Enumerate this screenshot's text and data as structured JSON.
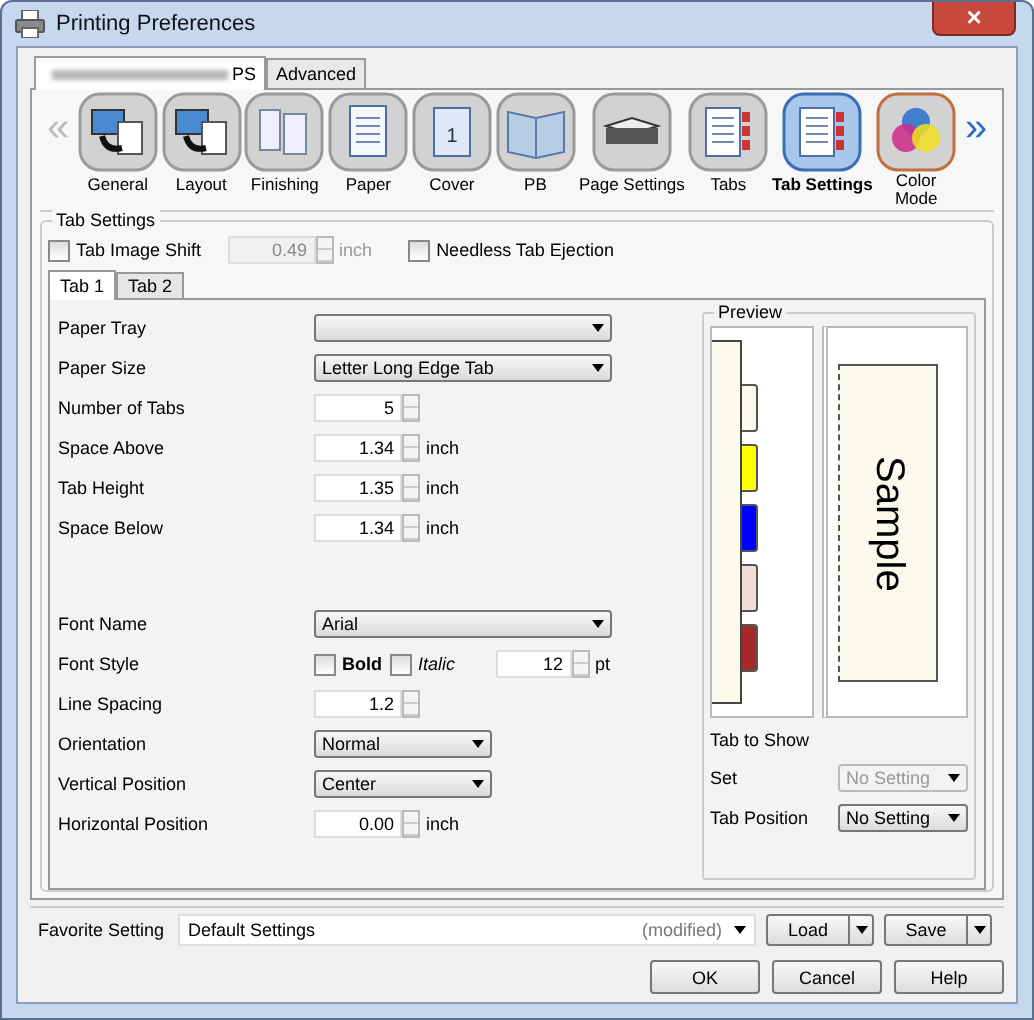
{
  "window": {
    "title": "Printing Preferences",
    "close": "×"
  },
  "outer_tabs": [
    {
      "label": "PS",
      "selected": true
    },
    {
      "label": "Advanced",
      "selected": false
    }
  ],
  "nav": {
    "prev": "«",
    "prev_disabled": true,
    "next": "»",
    "next_disabled": false
  },
  "categories": [
    {
      "kind": "general",
      "label": "General",
      "selected": false
    },
    {
      "kind": "layout",
      "label": "Layout",
      "selected": false
    },
    {
      "kind": "finishing",
      "label": "Finishing",
      "selected": false
    },
    {
      "kind": "paper",
      "label": "Paper",
      "selected": false
    },
    {
      "kind": "cover",
      "label": "Cover",
      "selected": false,
      "glyph": "1"
    },
    {
      "kind": "booklet",
      "label": "PB",
      "selected": false
    },
    {
      "kind": "stack",
      "label": "Page Settings",
      "selected": false
    },
    {
      "kind": "tabs",
      "label": "Tabs",
      "selected": false
    },
    {
      "kind": "tabsettings",
      "label": "Tab Settings",
      "selected": true
    },
    {
      "kind": "color",
      "label": "Color Mode",
      "selected": false
    }
  ],
  "tab_settings": {
    "title": "Tab Settings",
    "tab_image_shift": {
      "label": "Tab Image Shift",
      "checked": false,
      "value": "0.49",
      "unit": "inch",
      "disabled": true
    },
    "needless_tab_ejection": {
      "label": "Needless Tab Ejection",
      "checked": false
    }
  },
  "inner_tabs": [
    {
      "label": "Tab 1",
      "selected": true
    },
    {
      "label": "Tab 2",
      "selected": false
    }
  ],
  "fields_top": [
    {
      "kind": "select",
      "label": "Paper Tray"
    },
    {
      "kind": "select",
      "label": "Paper Size",
      "value": "Letter Long Edge Tab"
    },
    {
      "kind": "spin",
      "label": "Number of Tabs",
      "value": "5"
    },
    {
      "kind": "spin",
      "label": "Space Above",
      "value": "1.34",
      "unit": "inch"
    },
    {
      "kind": "spin",
      "label": "Tab Height",
      "value": "1.35",
      "unit": "inch"
    },
    {
      "kind": "spin",
      "label": "Space Below",
      "value": "1.34",
      "unit": "inch"
    }
  ],
  "fields_bottom": [
    {
      "kind": "select",
      "label": "Font Name",
      "value": "Arial"
    },
    {
      "kind": "font_style",
      "label": "Font Style",
      "bold": {
        "label": "Bold",
        "checked": false
      },
      "italic": {
        "label": "Italic",
        "checked": false
      },
      "value": "12",
      "unit": "pt"
    },
    {
      "kind": "spin",
      "label": "Line Spacing",
      "value": "1.2"
    },
    {
      "kind": "short_select",
      "label": "Orientation",
      "value": "Normal"
    },
    {
      "kind": "short_select",
      "label": "Vertical Position",
      "value": "Center"
    },
    {
      "kind": "spin",
      "label": "Horizontal Position",
      "value": "0.00",
      "unit": "inch"
    }
  ],
  "preview": {
    "title": "Preview",
    "tabs": [
      {
        "color": "#fbf8ec"
      },
      {
        "color": "#ffff00"
      },
      {
        "color": "#0000ff"
      },
      {
        "color": "#f0ded6"
      },
      {
        "color": "#a52a2a"
      }
    ],
    "sample": "Sample",
    "tab_to_show": "Tab to Show",
    "set": {
      "label": "Set",
      "value": "No Setting",
      "disabled": true
    },
    "tab_position": {
      "label": "Tab Position",
      "value": "No Setting",
      "disabled": false
    }
  },
  "favorite": {
    "label": "Favorite Setting",
    "value": "Default Settings",
    "note": "(modified)",
    "buttons": [
      "Load",
      "Save"
    ]
  },
  "buttons": [
    "OK",
    "Cancel",
    "Help"
  ]
}
